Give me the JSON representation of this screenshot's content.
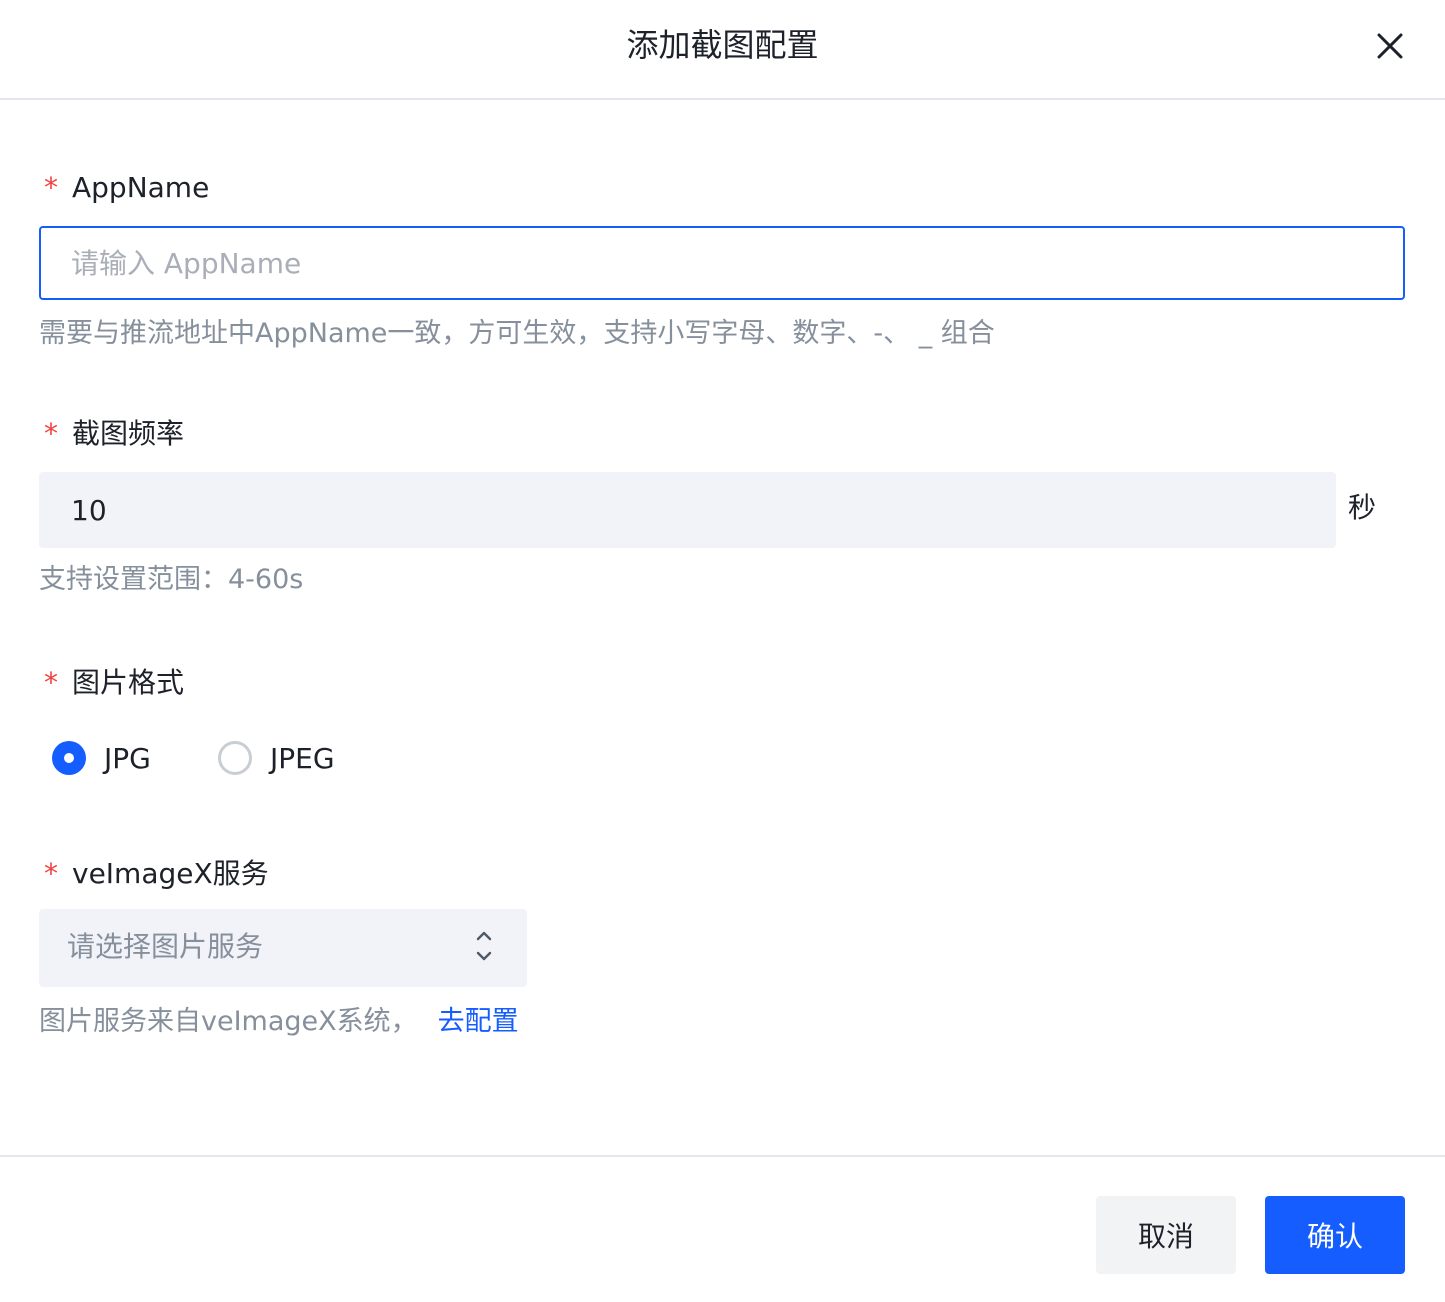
{
  "dialog": {
    "title": "添加截图配置"
  },
  "form": {
    "appname": {
      "required_mark": "*",
      "label": "AppName",
      "placeholder": "请输入 AppName",
      "value": "",
      "hint": "需要与推流地址中AppName一致，方可生效，支持小写字母、数字、-、 _ 组合"
    },
    "frequency": {
      "required_mark": "*",
      "label": "截图频率",
      "value": "10",
      "unit": "秒",
      "hint": "支持设置范围：4-60s"
    },
    "format": {
      "required_mark": "*",
      "label": "图片格式",
      "options": [
        {
          "label": "JPG",
          "checked": true
        },
        {
          "label": "JPEG",
          "checked": false
        }
      ]
    },
    "service": {
      "required_mark": "*",
      "label": "veImageX服务",
      "placeholder": "请选择图片服务",
      "hint": "图片服务来自veImageX系统，",
      "link": "去配置"
    }
  },
  "footer": {
    "cancel_label": "取消",
    "confirm_label": "确认"
  },
  "colors": {
    "primary": "#165dff",
    "required": "#f53f3f",
    "hint": "#86909c",
    "input_bg": "#f2f3f8"
  }
}
